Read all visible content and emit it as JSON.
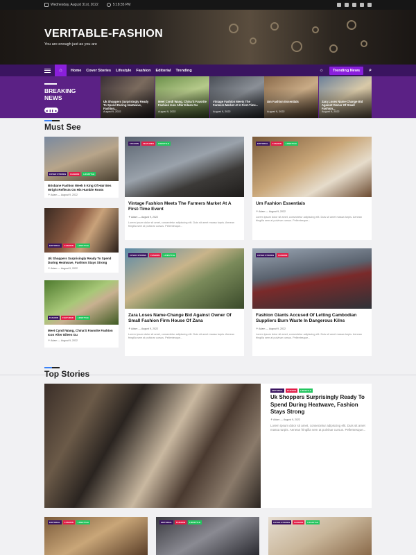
{
  "topbar": {
    "date": "Wednesday, August 31st, 2022",
    "time": "5:18:35 PM"
  },
  "site": {
    "title": "VERITABLE-FASHION",
    "tagline": "You are enough just as you are"
  },
  "nav": {
    "items": [
      "Home",
      "Cover Stories",
      "Lifestyle",
      "Fashion",
      "Editorial",
      "Trending"
    ],
    "trending_label": "Trending News"
  },
  "breaking": {
    "label_line1": "BREAKING",
    "label_line2": "NEWS",
    "cards": [
      {
        "title": "Uk Shoppers Surprisingly Ready To Spend During Heatwave, Fashion...",
        "date": "August 9, 2022"
      },
      {
        "title": "Meet Cyndi Wang, China'S Favorite Fashion Icon After Eileen Gu",
        "date": "August 9, 2022"
      },
      {
        "title": "Vintage Fashion Meets The Farmers Market At A First-Time...",
        "date": "August 9, 2022"
      },
      {
        "title": "Um Fashion Essentials",
        "date": "August 9, 2022"
      },
      {
        "title": "Zara Loses Name-Change Bid Against Owner Of Small Fashion...",
        "date": "August 9, 2022"
      }
    ]
  },
  "must_see": {
    "title": "Must See",
    "small": [
      {
        "tags": [
          "COVER STORIES",
          "FASHION",
          "LIFESTYLE"
        ],
        "title": "Brisbane Fashion Week 5 King Of Hair Bes Wright Reflects On His Humble Roots",
        "author": "Adam",
        "date": "August 9, 2022"
      },
      {
        "tags": [
          "EDITORIAL",
          "FASHION",
          "LIFESTYLE"
        ],
        "title": "Uk Shoppers Surprisingly Ready To Spend During Heatwave, Fashion Stays Strong",
        "author": "Adam",
        "date": "August 9, 2022"
      },
      {
        "tags": [
          "FASHION",
          "FEATURED",
          "LIFESTYLE"
        ],
        "title": "Meet Cyndi Wang, China'S Favorite Fashion Icon After Eileen Gu",
        "author": "Adam",
        "date": "August 9, 2022"
      }
    ],
    "big": [
      {
        "tags": [
          "FASHION",
          "FEATURED",
          "LIFESTYLE"
        ],
        "title": "Vintage Fashion Meets The Farmers Market At A First-Time Event",
        "author": "Adam",
        "date": "August 9, 2022",
        "excerpt": "Lorem ipsum dolor sit amet, consectetur adipiscing elit. Duis sit amet massa turpis. Aenean fringilla sem at pulvinar cursus. Pellentesque..."
      },
      {
        "tags": [
          "EDITORIAL",
          "FASHION",
          "LIFESTYLE"
        ],
        "title": "Um Fashion Essentials",
        "author": "Adam",
        "date": "August 9, 2022",
        "excerpt": "Lorem ipsum dolor sit amet, consectetur adipiscing elit. Duis sit amet massa turpis. Aenean fringilla sem at pulvinar cursus. Pellentesque..."
      },
      {
        "tags": [
          "COVER STORIES",
          "FASHION",
          "LIFESTYLE"
        ],
        "title": "Zara Loses Name-Change Bid Against Owner Of Small Fashion Firm House Of Zana",
        "author": "Adam",
        "date": "August 9, 2022",
        "excerpt": "Lorem ipsum dolor sit amet, consectetur adipiscing elit. Duis sit amet massa turpis. Aenean fringilla sem at pulvinar cursus. Pellentesque..."
      },
      {
        "tags": [
          "COVER STORIES",
          "FASHION"
        ],
        "title": "Fashion Giants Accused Of Letting Cambodian Suppliers Burn Waste In Dangerous Kilns",
        "author": "Adam",
        "date": "August 9, 2022",
        "excerpt": "Lorem ipsum dolor sit amet, consectetur adipiscing elit. Duis sit amet massa turpis. Aenean fringilla sem at pulvinar cursus. Pellentesque..."
      }
    ]
  },
  "top_stories": {
    "title": "Top Stories",
    "featured": {
      "tags": [
        "EDITORIAL",
        "FASHION",
        "LIFESTYLE"
      ],
      "title": "Uk Shoppers Surprisingly Ready To Spend During Heatwave, Fashion Stays Strong",
      "author": "Adam",
      "date": "August 9, 2022",
      "excerpt": "Lorem ipsum dolor sit amet, consectetur adipiscing elit. Duis sit amet massa turpis. Aenean fringilla sem at pulvinar cursus. Pellentesque..."
    },
    "row": [
      {
        "tags": [
          "EDITORIAL",
          "FASHION",
          "LIFESTYLE"
        ]
      },
      {
        "tags": [
          "EDITORIAL",
          "FASHION",
          "LIFESTYLE"
        ]
      },
      {
        "tags": [
          "COVER STORIES",
          "FASHION",
          "LIFESTYLE"
        ]
      }
    ]
  },
  "colors": {
    "nav": "#3a1460",
    "accent": "#8a1fdc",
    "breaking_bg": "#5b2185",
    "tag_red": "#e11d48",
    "tag_green": "#22c55e"
  }
}
